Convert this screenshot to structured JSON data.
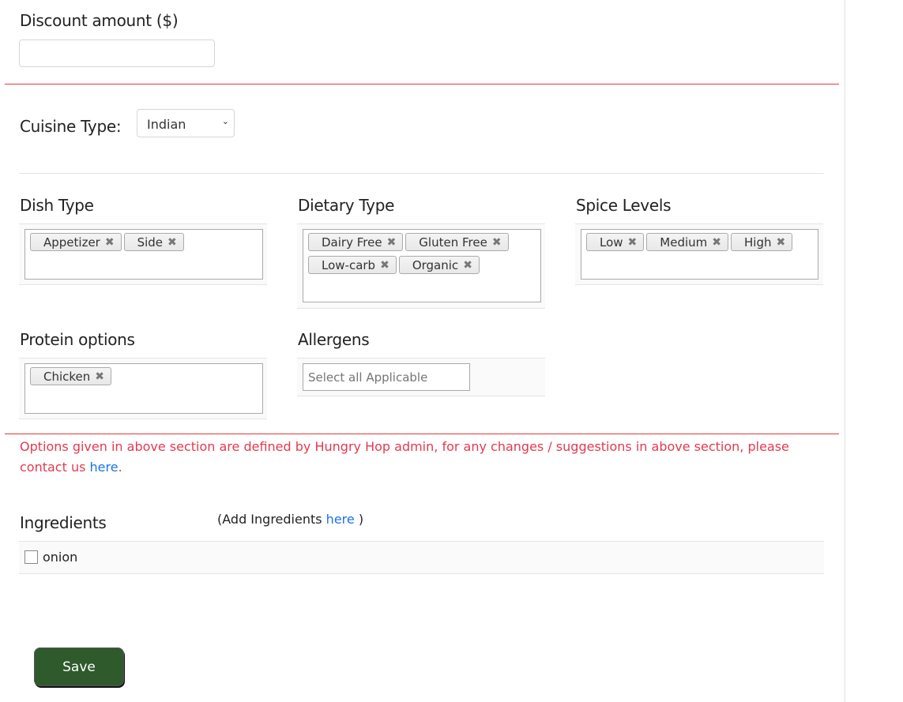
{
  "discount": {
    "label": "Discount amount ($)",
    "value": ""
  },
  "cuisine": {
    "label": "Cuisine Type:",
    "selected": "Indian"
  },
  "dish_type": {
    "label": "Dish Type",
    "tags": [
      "Appetizer",
      "Side"
    ]
  },
  "dietary_type": {
    "label": "Dietary Type",
    "tags": [
      "Dairy Free",
      "Gluten Free",
      "Low-carb",
      "Organic"
    ]
  },
  "spice_levels": {
    "label": "Spice Levels",
    "tags": [
      "Low",
      "Medium",
      "High"
    ]
  },
  "protein": {
    "label": "Protein options",
    "tags": [
      "Chicken"
    ]
  },
  "allergens": {
    "label": "Allergens",
    "placeholder": "Select all Applicable"
  },
  "notice": {
    "text": "Options given in above section are defined by Hungry Hop admin, for any changes / suggestions in above section, please contact us ",
    "link": "here",
    "end": "."
  },
  "ingredients": {
    "label": "Ingredients",
    "add_prefix": "(Add Ingredients ",
    "add_link": "here",
    "add_suffix": " )",
    "items": [
      {
        "name": "onion",
        "checked": false
      }
    ]
  },
  "save_label": "Save",
  "tag_remove": "✖"
}
